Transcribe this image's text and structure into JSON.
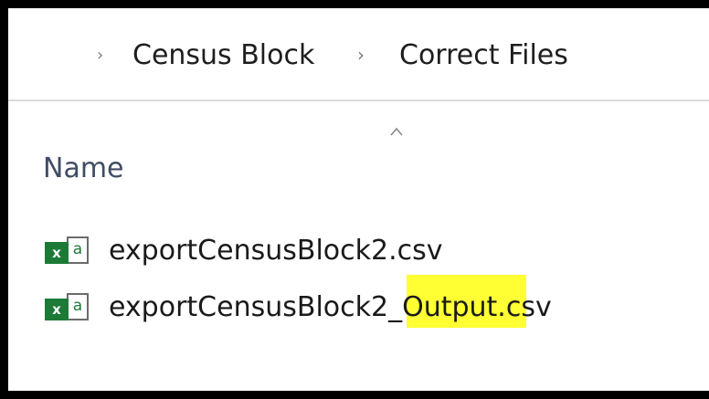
{
  "breadcrumb": {
    "separator_icon": "chevron-right-icon",
    "items": [
      "Census Block",
      "Correct Files"
    ]
  },
  "column_header": {
    "name_label": "Name",
    "sort_icon": "sort-ascending-caret-icon"
  },
  "files": [
    {
      "name": "exportCensusBlock2.csv",
      "icon": "excel-csv-file-icon"
    },
    {
      "name": "exportCensusBlock2_Output.csv",
      "icon": "excel-csv-file-icon"
    }
  ],
  "file_icon_glyphs": {
    "badge": "xa",
    "badge_letter": "x",
    "doc_letter": "a"
  },
  "colors": {
    "excel_green": "#1d7a36",
    "highlight": "#ffff33",
    "header_text": "#3f4d64"
  }
}
